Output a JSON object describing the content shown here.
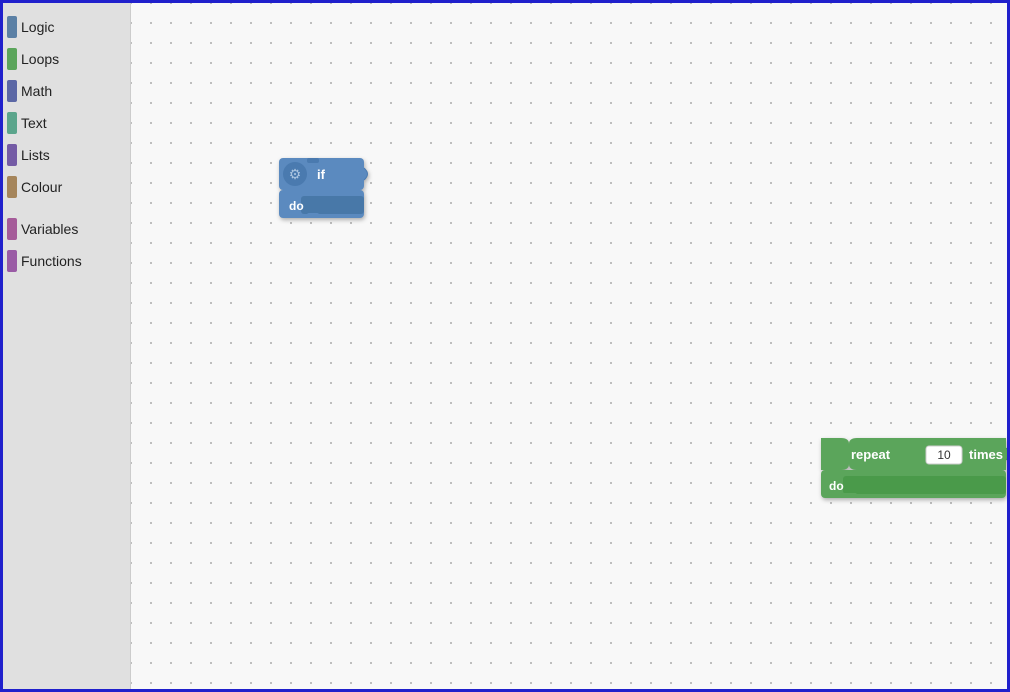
{
  "sidebar": {
    "items": [
      {
        "id": "logic",
        "label": "Logic",
        "color": "#5b80a5"
      },
      {
        "id": "loops",
        "label": "Loops",
        "color": "#5ba55b"
      },
      {
        "id": "math",
        "label": "Math",
        "color": "#5b67a5"
      },
      {
        "id": "text",
        "label": "Text",
        "color": "#5ba58c"
      },
      {
        "id": "lists",
        "label": "Lists",
        "color": "#745ba5"
      },
      {
        "id": "colour",
        "label": "Colour",
        "color": "#a5855b"
      },
      {
        "id": "variables",
        "label": "Variables",
        "color": "#a55b99"
      },
      {
        "id": "functions",
        "label": "Functions",
        "color": "#9a5ba5"
      }
    ]
  },
  "blocks": {
    "if_block": {
      "label_if": "if",
      "label_do": "do"
    },
    "repeat_block": {
      "label_repeat": "repeat",
      "label_times": "times",
      "label_do": "do",
      "value": "10"
    }
  },
  "canvas": {
    "background_color": "#f8f8f8",
    "dot_color": "#aaaaaa"
  }
}
